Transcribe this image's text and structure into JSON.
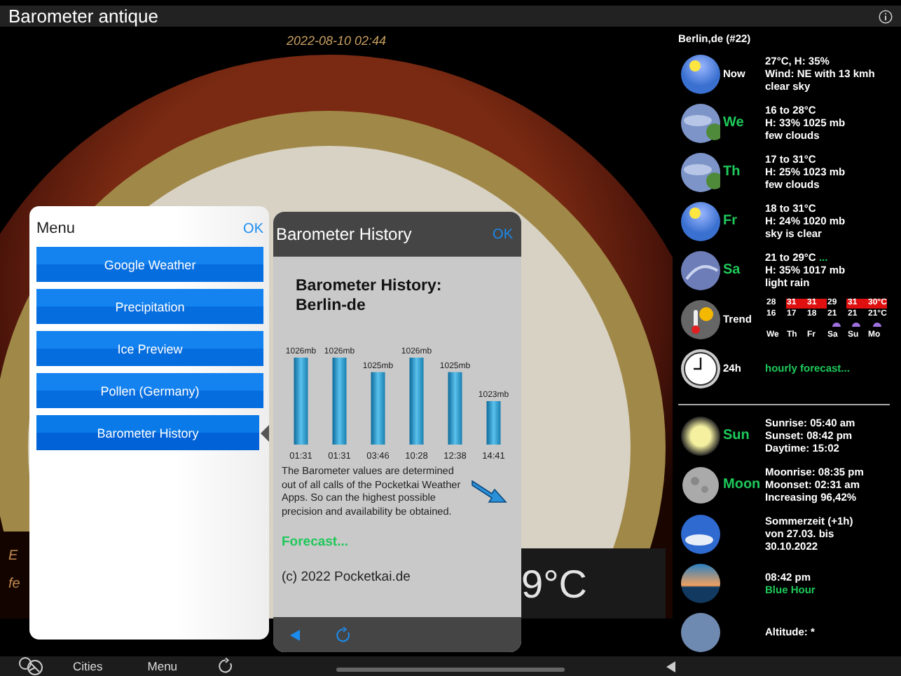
{
  "window": {
    "title": "Barometer antique"
  },
  "barometer": {
    "timestamp": "2022-08-10 02:44",
    "fragments": [
      {
        "text": "E",
        "kind": "caption"
      },
      {
        "text": "fe",
        "kind": "caption"
      },
      {
        "text": "9°C",
        "kind": "temperature"
      }
    ]
  },
  "sidebar": {
    "location": "Berlin,de (#22)",
    "rows": [
      {
        "kind": "sunny",
        "label": "Now",
        "accent": false,
        "lines": [
          {
            "text": "27°C, H: 35%",
            "accent": false
          },
          {
            "text": "Wind: NE with 13 kmh",
            "accent": false
          },
          {
            "text": "clear sky",
            "accent": false
          }
        ]
      },
      {
        "kind": "cloudy",
        "label": "We",
        "accent": true,
        "lines": [
          {
            "text": "16 to 28°C",
            "accent": false
          },
          {
            "text": "H: 33% 1025 mb",
            "accent": false
          },
          {
            "text": "few clouds",
            "accent": false
          }
        ]
      },
      {
        "kind": "cloudy",
        "label": "Th",
        "accent": true,
        "lines": [
          {
            "text": "17 to 31°C",
            "accent": false
          },
          {
            "text": "H: 25% 1023 mb",
            "accent": false
          },
          {
            "text": "few clouds",
            "accent": false
          }
        ]
      },
      {
        "kind": "sunny",
        "label": "Fr",
        "accent": true,
        "lines": [
          {
            "text": "18 to 31°C",
            "accent": false
          },
          {
            "text": "H: 24% 1020 mb",
            "accent": false
          },
          {
            "text": "sky is clear",
            "accent": false
          }
        ]
      },
      {
        "kind": "rain",
        "label": "Sa",
        "accent": true,
        "lines": [
          {
            "text": "21 to 29°C",
            "accent": false,
            "more": "..."
          },
          {
            "text": "H: 35% 1017 mb",
            "accent": false
          },
          {
            "text": "light rain",
            "accent": false
          }
        ]
      },
      {
        "kind": "trend",
        "label": "Trend",
        "accent": false,
        "trend": {
          "highs": [
            {
              "text": "28",
              "hot": false
            },
            {
              "text": "31",
              "hot": true
            },
            {
              "text": "31",
              "hot": true
            },
            {
              "text": "29",
              "hot": false
            },
            {
              "text": "31",
              "hot": true
            },
            {
              "text": "30°C",
              "hot": true
            }
          ],
          "lows": [
            "16",
            "17",
            "18",
            "21",
            "21",
            "21°C"
          ],
          "days": [
            {
              "name": "We",
              "rain": false
            },
            {
              "name": "Th",
              "rain": false
            },
            {
              "name": "Fr",
              "rain": false
            },
            {
              "name": "Sa",
              "rain": true
            },
            {
              "name": "Su",
              "rain": true
            },
            {
              "name": "Mo",
              "rain": true
            }
          ]
        }
      },
      {
        "kind": "clock",
        "label": "24h",
        "accent": false,
        "lines": [
          {
            "text": "hourly forecast...",
            "accent": true
          }
        ]
      }
    ],
    "astro_rows": [
      {
        "kind": "sun",
        "label": "Sun",
        "accent": true,
        "lines": [
          {
            "text": "Sunrise: 05:40 am",
            "accent": false
          },
          {
            "text": "Sunset: 08:42 pm",
            "accent": false
          },
          {
            "text": "Daytime: 15:02",
            "accent": false
          }
        ]
      },
      {
        "kind": "moon",
        "label": "Moon",
        "accent": true,
        "lines": [
          {
            "text": "Moonrise: 08:35 pm",
            "accent": false
          },
          {
            "text": "Moonset: 02:31 am",
            "accent": false
          },
          {
            "text": "Increasing 96,42%",
            "accent": false
          }
        ]
      },
      {
        "kind": "sky",
        "lines": [
          {
            "text": "Sommerzeit (+1h)",
            "accent": false
          },
          {
            "text": "von 27.03. bis",
            "accent": false
          },
          {
            "text": "30.10.2022",
            "accent": false
          }
        ]
      },
      {
        "kind": "dusk",
        "lines": [
          {
            "text": "08:42 pm",
            "accent": false
          },
          {
            "text": "Blue Hour",
            "accent": true
          }
        ]
      },
      {
        "kind": "globe",
        "lines": [
          {
            "text": "Altitude: *",
            "accent": false
          }
        ]
      }
    ]
  },
  "menu": {
    "title": "Menu",
    "ok": "OK",
    "items": [
      {
        "label": "Google Weather",
        "selected": false
      },
      {
        "label": "Precipitation",
        "selected": false
      },
      {
        "label": "Ice Preview",
        "selected": false
      },
      {
        "label": "Pollen (Germany)",
        "selected": false
      },
      {
        "label": "Barometer History",
        "selected": true
      }
    ]
  },
  "history_dialog": {
    "title": "Barometer History",
    "ok": "OK",
    "heading": "Barometer History:\nBerlin-de",
    "chart_data": {
      "type": "bar",
      "categories": [
        "01:31",
        "01:31",
        "03:46",
        "10:28",
        "12:38",
        "14:41"
      ],
      "values": [
        1026,
        1026,
        1025,
        1026,
        1025,
        1023
      ],
      "value_labels": [
        "1026mb",
        "1026mb",
        "1025mb",
        "1026mb",
        "1025mb",
        "1023mb"
      ],
      "ylim": [
        1020,
        1026
      ]
    },
    "note": "The Barometer values are determined out of all calls of the Pocketkai Weather Apps. So can the highest possible precision and availability be obtained.",
    "link": "Forecast...",
    "copyright": "(c) 2022 Pocketkai.de"
  },
  "bottom_bar": {
    "tabs": [
      {
        "label": "Cities"
      },
      {
        "label": "Menu"
      }
    ]
  }
}
